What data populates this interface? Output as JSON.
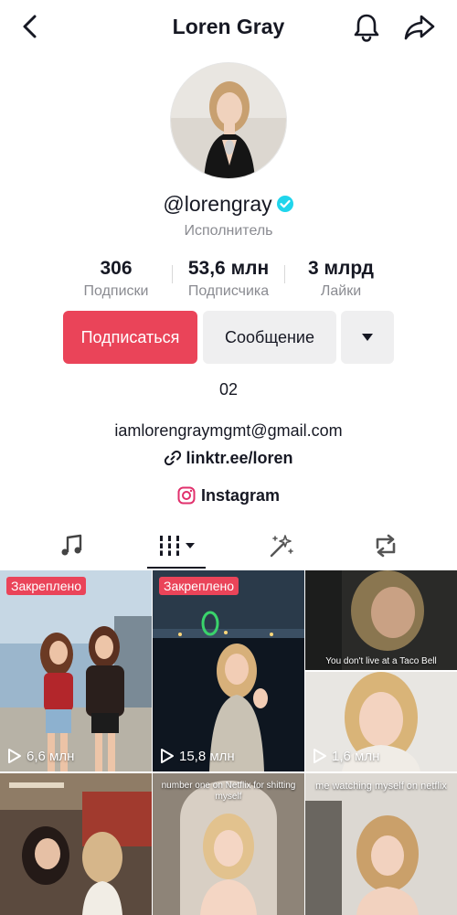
{
  "header": {
    "title": "Loren Gray",
    "back_icon": "chevron-left-icon",
    "bell_icon": "bell-icon",
    "share_icon": "share-arrow-icon"
  },
  "profile": {
    "handle": "@lorengray",
    "verified": true,
    "category": "Исполнитель",
    "bio": "02",
    "email": "iamlorengraymgmt@gmail.com",
    "link": "linktr.ee/loren",
    "instagram_label": "Instagram"
  },
  "stats": [
    {
      "value": "306",
      "label": "Подписки"
    },
    {
      "value": "53,6 млн",
      "label": "Подписчика"
    },
    {
      "value": "3 млрд",
      "label": "Лайки"
    }
  ],
  "actions": {
    "follow_label": "Подписаться",
    "message_label": "Сообщение"
  },
  "tabs": [
    "music-note-icon",
    "videos-grid-icon",
    "magic-wand-icon",
    "repost-icon"
  ],
  "videos": [
    {
      "pinned_label": "Закреплено",
      "views": "6,6 млн",
      "caption": ""
    },
    {
      "pinned_label": "Закреплено",
      "views": "15,8 млн",
      "caption": ""
    },
    {
      "pinned_label": "",
      "views": "",
      "caption": "You don't live at a Taco Bell"
    },
    {
      "pinned_label": "",
      "views": "1,6 млн",
      "caption": ""
    },
    {
      "pinned_label": "",
      "views": "",
      "caption": ""
    },
    {
      "pinned_label": "",
      "views": "",
      "caption": "number one on Netflix for shitting myself"
    },
    {
      "pinned_label": "",
      "views": "",
      "caption": "me watching myself on netflix"
    }
  ],
  "colors": {
    "accent": "#ea4459",
    "verified": "#20d5ec",
    "muted_text": "#8a8b91",
    "button_gray": "#efeff0"
  }
}
